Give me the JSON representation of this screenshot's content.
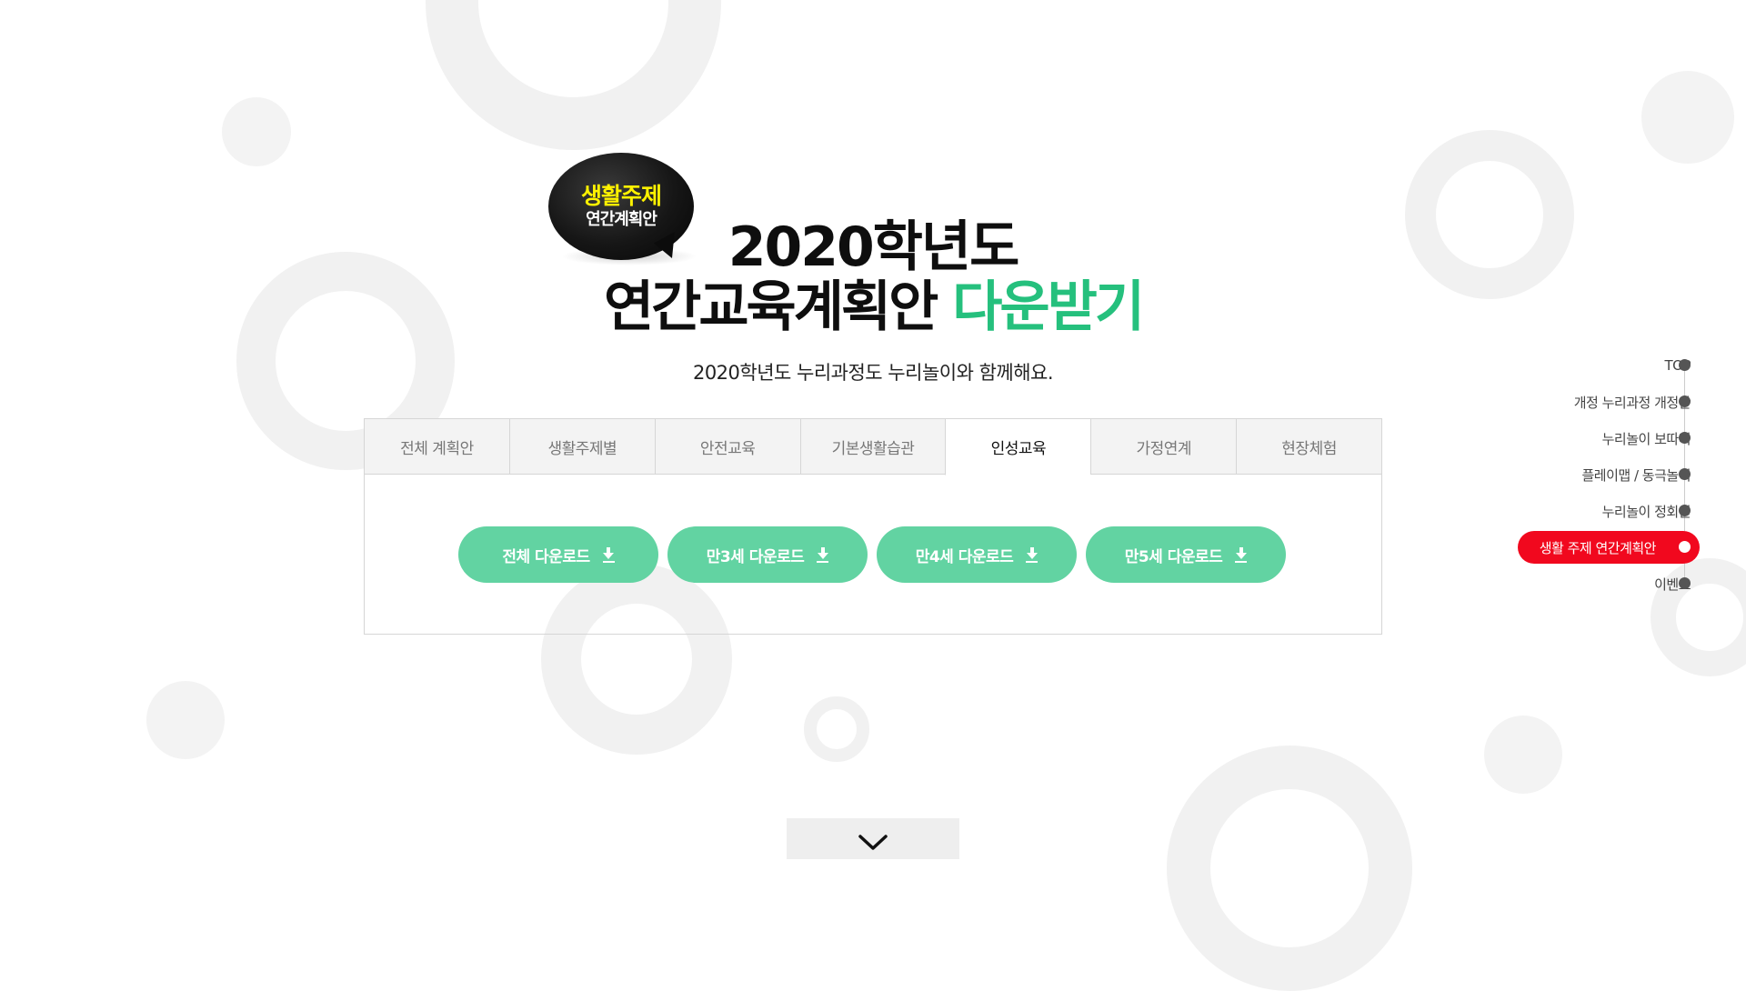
{
  "badge": {
    "line1": "생활주제",
    "line2": "연간계획안"
  },
  "title": {
    "line1": "2020학년도",
    "line2_black": "연간교육계획안",
    "line2_accent": "다운받기"
  },
  "subtitle": "2020학년도 누리과정도 누리놀이와 함께해요.",
  "tabs": [
    {
      "label": "전체 계획안",
      "active": false
    },
    {
      "label": "생활주제별",
      "active": false
    },
    {
      "label": "안전교육",
      "active": false
    },
    {
      "label": "기본생활습관",
      "active": false
    },
    {
      "label": "인성교육",
      "active": true
    },
    {
      "label": "가정연계",
      "active": false
    },
    {
      "label": "현장체험",
      "active": false
    }
  ],
  "downloads": [
    {
      "label": "전체 다운로드"
    },
    {
      "label": "만3세 다운로드"
    },
    {
      "label": "만4세 다운로드"
    },
    {
      "label": "만5세 다운로드"
    }
  ],
  "side_nav": [
    {
      "label": "TOP",
      "active": false
    },
    {
      "label": "개정 누리과정 개정안",
      "active": false
    },
    {
      "label": "누리놀이 보따리",
      "active": false
    },
    {
      "label": "플레이맵 / 동극놀이",
      "active": false
    },
    {
      "label": "누리놀이 정회원",
      "active": false
    },
    {
      "label": "생활 주제 연간계획안",
      "active": true
    },
    {
      "label": "이벤트",
      "active": false
    }
  ],
  "colors": {
    "accent_green": "#25c07d",
    "button_green": "#62d3a2",
    "active_red": "#f1081e",
    "badge_yellow": "#fff200"
  },
  "icons": {
    "download": "download-arrow-icon",
    "scroll": "chevron-down-icon"
  }
}
